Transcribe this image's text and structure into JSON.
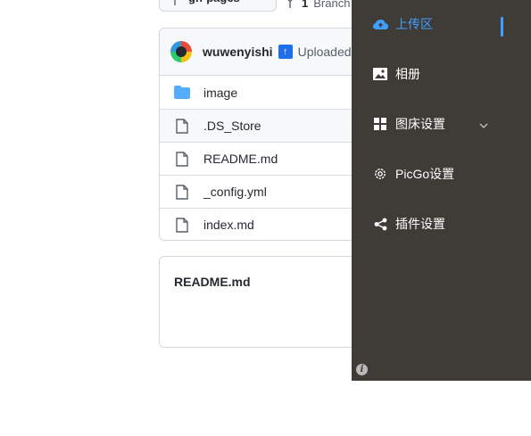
{
  "github": {
    "branch_selector": {
      "label": "gh-pages"
    },
    "branches_link": {
      "label": "Branch"
    },
    "commit": {
      "user": "wuwenyishi",
      "message": "Uploaded by"
    },
    "files": [
      {
        "name": "image",
        "type": "folder-icon"
      },
      {
        "name": ".DS_Store",
        "type": "file-icon"
      },
      {
        "name": "README.md",
        "type": "file-icon"
      },
      {
        "name": "_config.yml",
        "type": "file-icon"
      },
      {
        "name": "index.md",
        "type": "file-icon"
      }
    ],
    "readme": {
      "title": "README.md"
    }
  },
  "picgo_sidebar": {
    "items": [
      {
        "label": "上传区",
        "icon": "cloud-upload-icon",
        "active": true
      },
      {
        "label": "相册",
        "icon": "picture-icon",
        "active": false
      },
      {
        "label": "图床设置",
        "icon": "grid-icon",
        "active": false,
        "expandable": true
      },
      {
        "label": "PicGo设置",
        "icon": "gear-icon",
        "active": false
      },
      {
        "label": "插件设置",
        "icon": "share-icon",
        "active": false
      }
    ],
    "info_icon": "info-icon",
    "colors": {
      "background": "#3f3b36",
      "accent": "#409eff",
      "text": "#ffffff"
    }
  }
}
